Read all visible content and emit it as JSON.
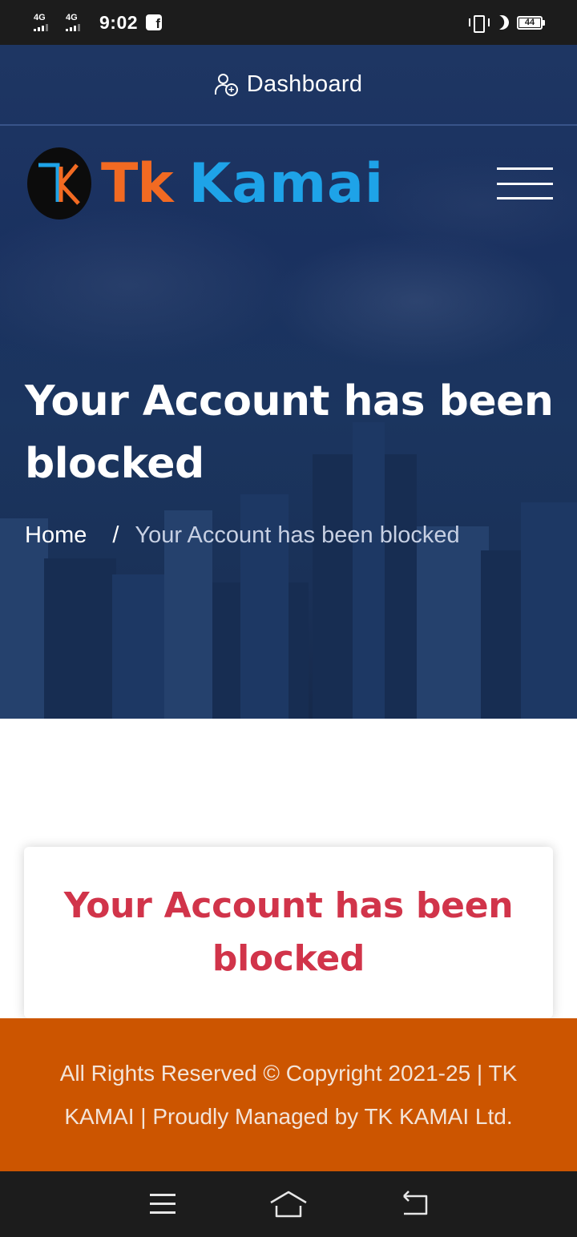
{
  "status_bar": {
    "net1": "4G",
    "net2": "4G",
    "time": "9:02",
    "battery": "44"
  },
  "header": {
    "dashboard_label": "Dashboard",
    "brand_tk": "Tk",
    "brand_kamai": "Kamai",
    "colors": {
      "tk": "#f26a22",
      "kamai": "#1ea3e8",
      "hero": "#1e3663"
    }
  },
  "hero": {
    "title": "Your Account has been blocked",
    "breadcrumb": {
      "home": "Home",
      "separator": "/",
      "current": "Your Account has been blocked"
    }
  },
  "card": {
    "message": "Your Account has been blocked",
    "color": "#d1344a"
  },
  "footer": {
    "text": "All Rights Reserved © Copyright 2021-25 | TK KAMAI | Proudly Managed by TK KAMAI Ltd.",
    "color": "#cc5500"
  },
  "navbar": {
    "icons": [
      "menu-icon",
      "home-icon",
      "back-icon"
    ]
  }
}
